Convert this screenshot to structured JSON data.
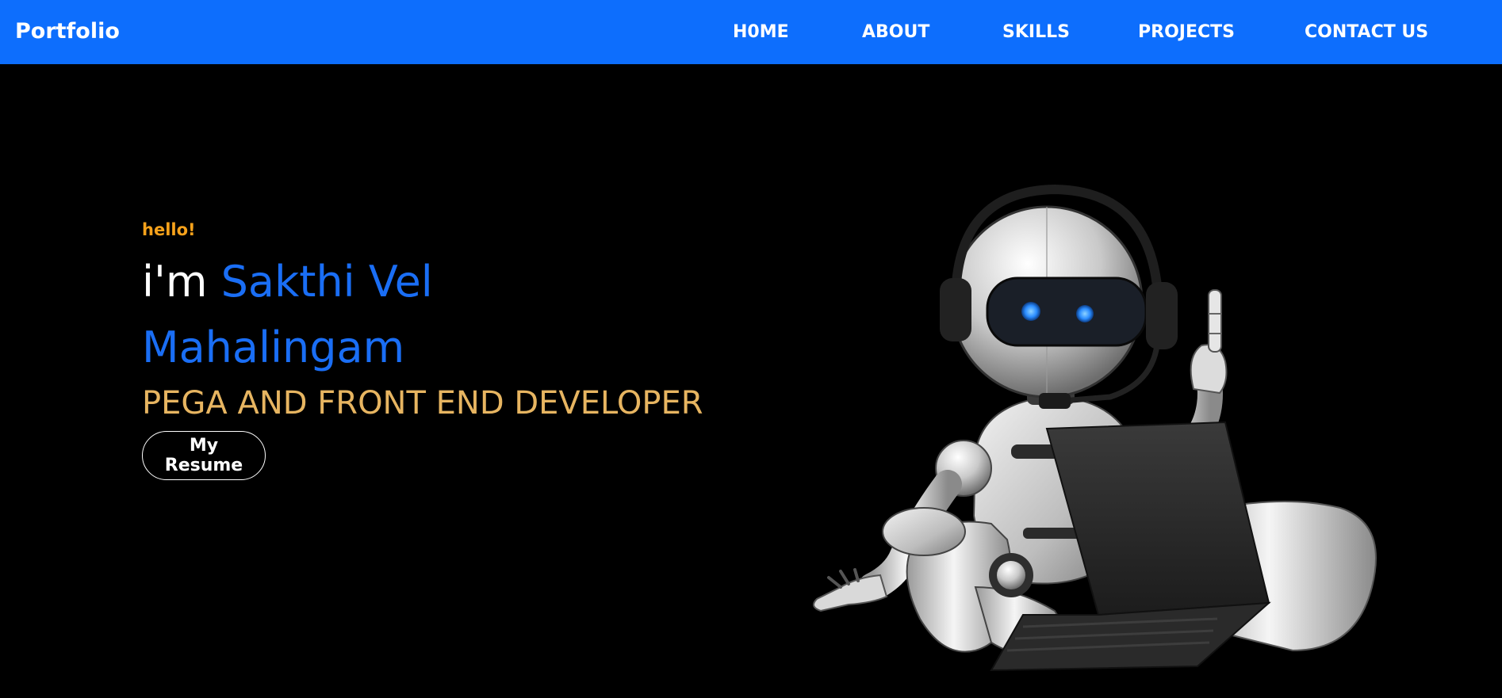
{
  "navbar": {
    "brand": "Portfolio",
    "links": [
      "H0ME",
      "ABOUT",
      "SKILLS",
      "PROJECTS",
      "CONTACT US"
    ],
    "bg_color": "#0d6efd"
  },
  "hero": {
    "hello": "hello!",
    "im": "i'm ",
    "name_first": "Sakthi Vel",
    "name_last": "Mahalingam",
    "role": "PEGA AND FRONT END DEVELOPER",
    "resume_label": "My Resume",
    "colors": {
      "hello": "#f7a21b",
      "name": "#1a6ef5",
      "role": "#e7b561"
    },
    "illustration": "robot-with-headset-and-laptop"
  }
}
